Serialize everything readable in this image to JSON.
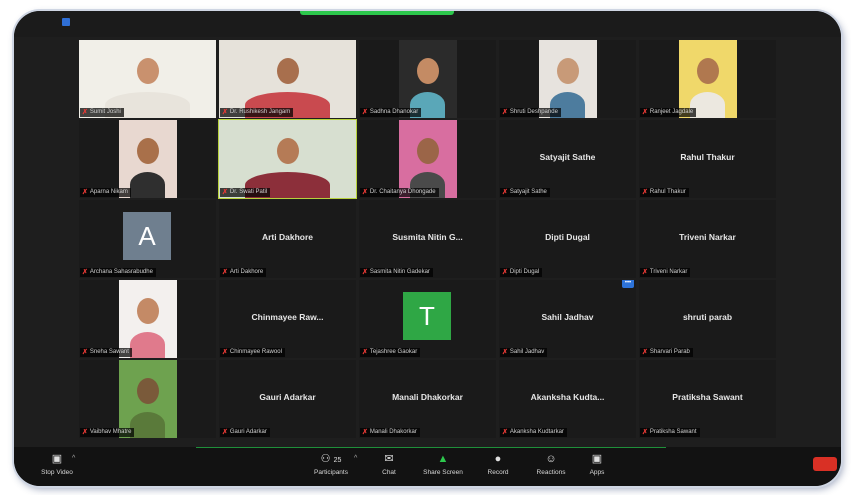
{
  "tiles": [
    {
      "label": "Sumit Joshi",
      "kind": "photo",
      "bg": "#f1efe8",
      "skin": "#c9916e",
      "shirt": "#e8e4dc"
    },
    {
      "label": "Dr. Rushikesh Jangam",
      "kind": "photo",
      "bg": "#e6e2da",
      "skin": "#a86f4d",
      "shirt": "#c94a4f"
    },
    {
      "label": "Sadhna Dhanokar",
      "kind": "photo",
      "bg": "#2b2b2b",
      "skin": "#c48b64",
      "shirt": "#5aa7b8"
    },
    {
      "label": "Shruti Deshpande",
      "kind": "photo",
      "bg": "#e7e3de",
      "skin": "#c89a78",
      "shirt": "#4d7c9e"
    },
    {
      "label": "Ranjeet Jagdale",
      "kind": "photo",
      "bg": "#f0d86a",
      "skin": "#b0784f",
      "shirt": "#ece8e0"
    },
    {
      "label": "Aparna Nikam",
      "kind": "photo",
      "bg": "#e8d8d0",
      "skin": "#a9704a",
      "shirt": "#2f2f2f"
    },
    {
      "label": "Dr. Swati Patil",
      "kind": "photo",
      "bg": "#d7dfd0",
      "skin": "#b57b56",
      "shirt": "#8c2f3a",
      "selected": true
    },
    {
      "label": "Dr. Chaitanya Dhongade",
      "kind": "photo",
      "bg": "#d86ea0",
      "skin": "#9b6548",
      "shirt": "#4a4a4a"
    },
    {
      "label": "Satyajit Sathe",
      "name": "Satyajit Sathe",
      "kind": "name"
    },
    {
      "label": "Rahul Thakur",
      "name": "Rahul Thakur",
      "kind": "name"
    },
    {
      "label": "Archana Sahasrabudhe",
      "kind": "avatar",
      "letter": "A",
      "color": "#6f7f8f"
    },
    {
      "label": "Arti Dakhore",
      "name": "Arti Dakhore",
      "kind": "name"
    },
    {
      "label": "Sasmita Nitin Gadekar",
      "name": "Susmita Nitin G...",
      "kind": "name"
    },
    {
      "label": "Dipti Dugal",
      "name": "Dipti Dugal",
      "kind": "name"
    },
    {
      "label": "Triveni Narkar",
      "name": "Triveni Narkar",
      "kind": "name"
    },
    {
      "label": "Sneha Sawant",
      "kind": "photo",
      "bg": "#f3f0ee",
      "skin": "#c48a66",
      "shirt": "#e07a8c"
    },
    {
      "label": "Chinmayee Rawool",
      "name": "Chinmayee  Raw...",
      "kind": "name"
    },
    {
      "label": "Tejashree Gaokar",
      "kind": "avatar",
      "letter": "T",
      "color": "#2fa745"
    },
    {
      "label": "Sahil Jadhav",
      "name": "Sahil Jadhav",
      "kind": "name",
      "badge": true
    },
    {
      "label": "Sharvari Parab",
      "name": "shruti parab",
      "kind": "name"
    },
    {
      "label": "Vaibhav Mhatre",
      "kind": "photo",
      "bg": "#6ea24f",
      "skin": "#7a5a3a",
      "shirt": "#5a7a3a"
    },
    {
      "label": "Gauri Adarkar",
      "name": "Gauri Adarkar",
      "kind": "name"
    },
    {
      "label": "Manali Dhakorkar",
      "name": "Manali Dhakorkar",
      "kind": "name"
    },
    {
      "label": "Akanksha Kudtarkar",
      "name": "Akanksha Kudta...",
      "kind": "name"
    },
    {
      "label": "Pratiksha Sawant",
      "name": "Pratiksha Sawant",
      "kind": "name"
    }
  ],
  "toolbar": {
    "stop_video": "Stop Video",
    "participants": "Participants",
    "participants_count": "25",
    "chat": "Chat",
    "share_screen": "Share Screen",
    "record": "Record",
    "reactions": "Reactions",
    "apps": "Apps"
  },
  "colors": {
    "accent_green": "#2dc84d",
    "mic_muted": "#e53935",
    "end_button": "#d93025"
  }
}
